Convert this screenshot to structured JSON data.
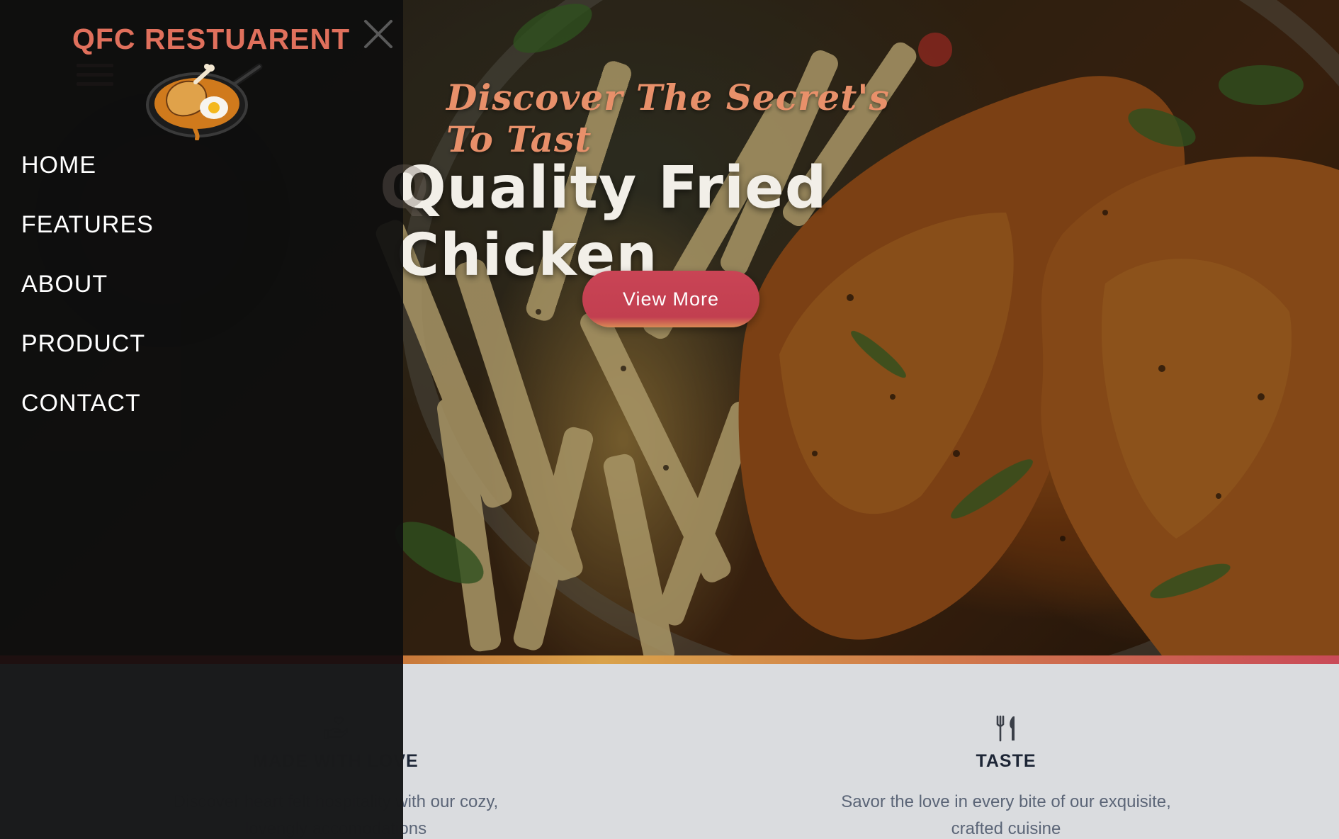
{
  "brand": {
    "name": "QFC RESTUARENT"
  },
  "nav": {
    "items": [
      "HOME",
      "FEATURES",
      "ABOUT",
      "PRODUCT",
      "CONTACT"
    ]
  },
  "hero": {
    "tagline": "Discover The Secret's To Tast",
    "headline": "Quality Fried Chicken",
    "cta_label": "View More"
  },
  "features": [
    {
      "icon": "hand-heart-icon",
      "title": "MADE WITH LOVE",
      "description": "Discover heart felt hospitality with our cozy, lovengly accomodations"
    },
    {
      "icon": "fork-knife-icon",
      "title": "TASTE",
      "description": "Savor the love in every bite of our exquisite, crafted cuisine"
    }
  ],
  "colors": {
    "brand": "#e0705c",
    "cta": "#c23f50",
    "sidebar_bg": "#0e0e0e",
    "features_bg": "#dadcdf",
    "heading_dark": "#1d2636"
  }
}
